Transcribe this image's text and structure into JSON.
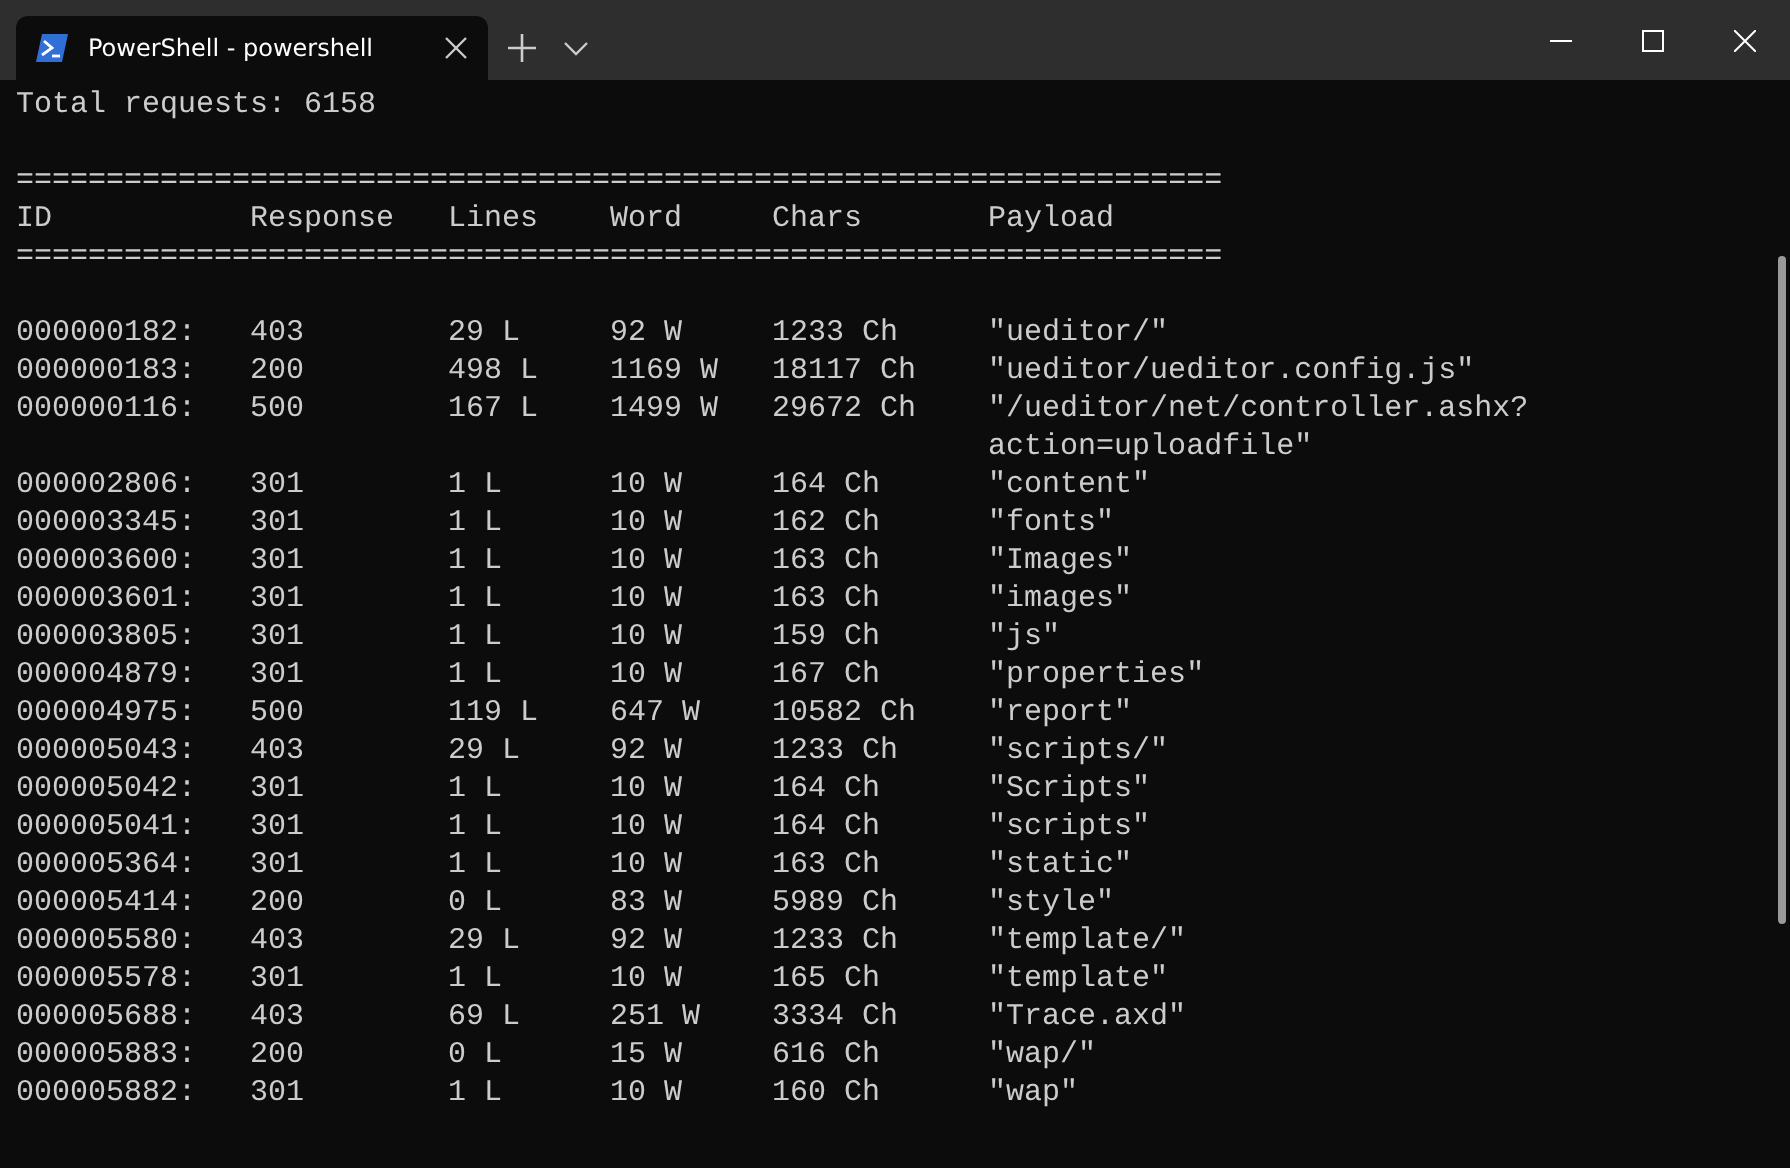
{
  "window": {
    "tabs": [
      {
        "title": "PowerShell - powershell",
        "selected": true
      }
    ]
  },
  "terminal": {
    "total": "Total requests: 6158",
    "separator_top": "===================================================================",
    "columns": [
      "ID",
      "Response",
      "Lines",
      "Word",
      "Chars",
      "Payload"
    ],
    "separator_bottom": "===================================================================",
    "rows": [
      [
        "000000182:",
        "403",
        "29 L",
        "92 W",
        "1233 Ch",
        "\"ueditor/\""
      ],
      [
        "000000183:",
        "200",
        "498 L",
        "1169 W",
        "18117 Ch",
        "\"ueditor/ueditor.config.js\""
      ],
      [
        "000000116:",
        "500",
        "167 L",
        "1499 W",
        "29672 Ch",
        "\"/ueditor/net/controller.ashx?action=uploadfile\""
      ],
      [
        "000002806:",
        "301",
        "1 L",
        "10 W",
        "164 Ch",
        "\"content\""
      ],
      [
        "000003345:",
        "301",
        "1 L",
        "10 W",
        "162 Ch",
        "\"fonts\""
      ],
      [
        "000003600:",
        "301",
        "1 L",
        "10 W",
        "163 Ch",
        "\"Images\""
      ],
      [
        "000003601:",
        "301",
        "1 L",
        "10 W",
        "163 Ch",
        "\"images\""
      ],
      [
        "000003805:",
        "301",
        "1 L",
        "10 W",
        "159 Ch",
        "\"js\""
      ],
      [
        "000004879:",
        "301",
        "1 L",
        "10 W",
        "167 Ch",
        "\"properties\""
      ],
      [
        "000004975:",
        "500",
        "119 L",
        "647 W",
        "10582 Ch",
        "\"report\""
      ],
      [
        "000005043:",
        "403",
        "29 L",
        "92 W",
        "1233 Ch",
        "\"scripts/\""
      ],
      [
        "000005042:",
        "301",
        "1 L",
        "10 W",
        "164 Ch",
        "\"Scripts\""
      ],
      [
        "000005041:",
        "301",
        "1 L",
        "10 W",
        "164 Ch",
        "\"scripts\""
      ],
      [
        "000005364:",
        "301",
        "1 L",
        "10 W",
        "163 Ch",
        "\"static\""
      ],
      [
        "000005414:",
        "200",
        "0 L",
        "83 W",
        "5989 Ch",
        "\"style\""
      ],
      [
        "000005580:",
        "403",
        "29 L",
        "92 W",
        "1233 Ch",
        "\"template/\""
      ],
      [
        "000005578:",
        "301",
        "1 L",
        "10 W",
        "165 Ch",
        "\"template\""
      ],
      [
        "000005688:",
        "403",
        "69 L",
        "251 W",
        "3334 Ch",
        "\"Trace.axd\""
      ],
      [
        "000005883:",
        "200",
        "0 L",
        "15 W",
        "616 Ch",
        "\"wap/\""
      ],
      [
        "000005882:",
        "301",
        "1 L",
        "10 W",
        "160 Ch",
        "\"wap\""
      ]
    ]
  }
}
